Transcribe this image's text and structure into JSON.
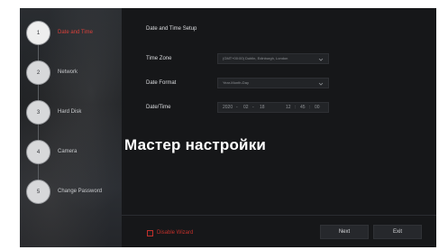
{
  "sidebar": {
    "steps": [
      {
        "number": "1",
        "label": "Date and Time"
      },
      {
        "number": "2",
        "label": "Network"
      },
      {
        "number": "3",
        "label": "Hard Disk"
      },
      {
        "number": "4",
        "label": "Camera"
      },
      {
        "number": "5",
        "label": "Change Password"
      }
    ],
    "active_step": 1
  },
  "main": {
    "title": "Date and Time Setup",
    "time_zone": {
      "label": "Time Zone",
      "value": "(GMT+00:00) Dublin, Edinburgh, London",
      "icon": "chevron-down-icon"
    },
    "date_format": {
      "label": "Date Format",
      "value": "Year-Month-Day",
      "icon": "chevron-down-icon"
    },
    "date_time": {
      "label": "Date/Time",
      "year": "2020",
      "month": "02",
      "day": "18",
      "hour": "12",
      "minute": "45",
      "second": "00",
      "date_sep": "-",
      "time_sep": ":"
    },
    "overlay_caption": "Мастер настройки",
    "disable_wizard_label": "Disable Wizard",
    "next_label": "Next",
    "exit_label": "Exit"
  },
  "colors": {
    "accent": "#d8403a",
    "background": "#161719",
    "sidebar": "#25282c"
  }
}
